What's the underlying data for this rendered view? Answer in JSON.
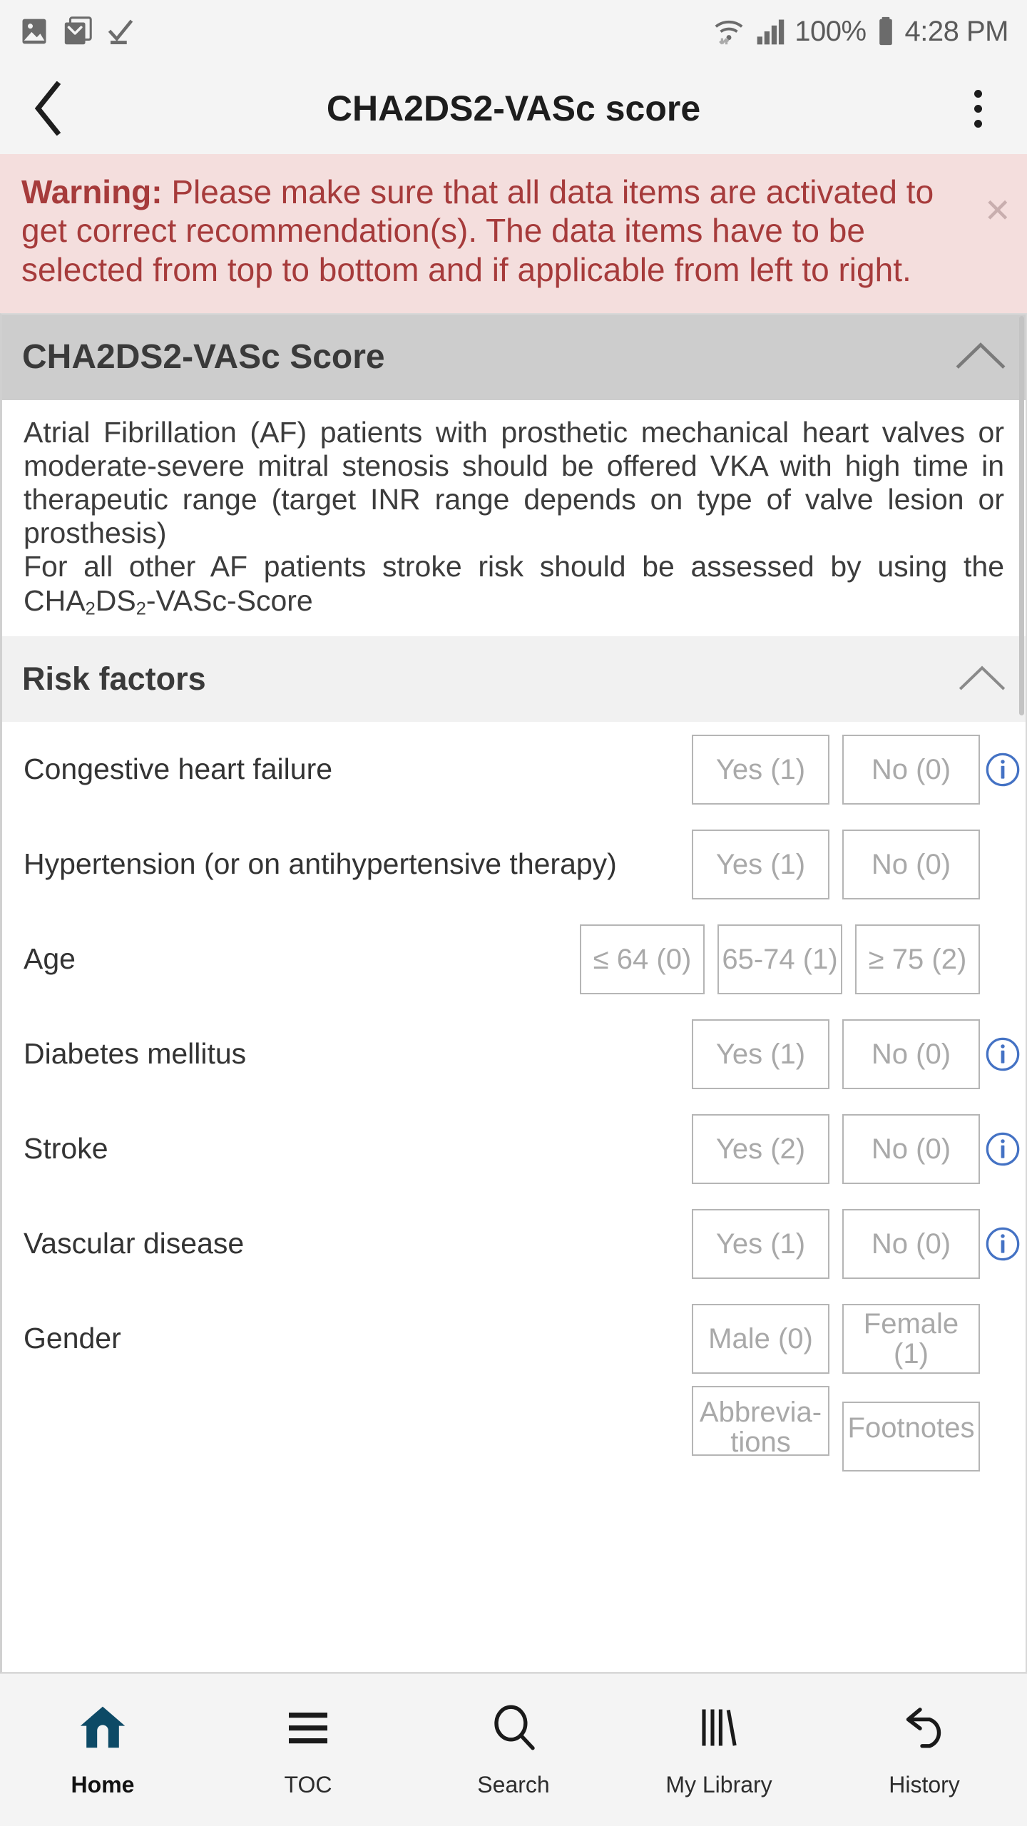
{
  "statusbar": {
    "battery_percent": "100%",
    "time": "4:28 PM",
    "icons": [
      "gallery-icon",
      "mail-icon",
      "check-icon",
      "wifi-icon",
      "signal-icon",
      "battery-icon"
    ]
  },
  "appbar": {
    "title": "CHA2DS2-VASc score",
    "back_label": "Back",
    "menu_label": "More options"
  },
  "warning": {
    "prefix": "Warning:",
    "text": " Please make sure that all data items are activated to get correct recommendation(s). The data items have to be selected from top to bottom and if applicable from left to right.",
    "close_label": "✕"
  },
  "score_section": {
    "title": "CHA2DS2-VASc Score",
    "collapse_icon": "chevron-up-icon",
    "paragraph_line1": "Atrial Fibrillation (AF) patients with prosthetic mechanical heart valves or moderate-severe mitral stenosis should be offered VKA with high time in therapeutic range (target INR range depends on type of valve lesion or prosthesis)",
    "paragraph_line2_prefix": "For all other AF patients stroke risk should be assessed by using the CHA",
    "sub1": "2",
    "paragraph_mid": "DS",
    "sub2": "2",
    "paragraph_suffix": "-VASc-Score"
  },
  "risk_section": {
    "title": "Risk factors",
    "collapse_icon": "chevron-up-icon",
    "rows": [
      {
        "label": "Congestive heart failure",
        "options": [
          "Yes (1)",
          "No (0)"
        ],
        "info": true,
        "width": "w2"
      },
      {
        "label": "Hypertension (or on antihypertensive therapy)",
        "options": [
          "Yes (1)",
          "No (0)"
        ],
        "info": false,
        "width": "w2"
      },
      {
        "label": "Age",
        "options": [
          "≤ 64 (0)",
          "65-74 (1)",
          "≥ 75 (2)"
        ],
        "info": false,
        "width": "w3"
      },
      {
        "label": "Diabetes mellitus",
        "options": [
          "Yes (1)",
          "No (0)"
        ],
        "info": true,
        "width": "w2"
      },
      {
        "label": "Stroke",
        "options": [
          "Yes (2)",
          "No (0)"
        ],
        "info": true,
        "width": "w2"
      },
      {
        "label": "Vascular disease",
        "options": [
          "Yes (1)",
          "No (0)"
        ],
        "info": true,
        "width": "w2"
      },
      {
        "label": "Gender",
        "options": [
          "Male (0)",
          "Female (1)"
        ],
        "info": false,
        "width": "w2"
      }
    ],
    "partial_row": {
      "label": "",
      "options": [
        "Abbrevia-tions",
        "Footnotes"
      ]
    }
  },
  "bottomnav": {
    "items": [
      {
        "label": "Home",
        "icon": "home-icon",
        "active": true
      },
      {
        "label": "TOC",
        "icon": "list-icon",
        "active": false
      },
      {
        "label": "Search",
        "icon": "search-icon",
        "active": false
      },
      {
        "label": "My Library",
        "icon": "books-icon",
        "active": false
      },
      {
        "label": "History",
        "icon": "undo-icon",
        "active": false
      }
    ]
  },
  "colors": {
    "warning_bg": "#f4dedd",
    "warning_text": "#a63b3b",
    "section_header_dark": "#cdcdcd",
    "section_header_light": "#f1f1f1",
    "info_icon": "#4472c4",
    "nav_active": "#0d4a66",
    "button_border": "#b5b5b5",
    "button_text": "#a9a9a9"
  }
}
